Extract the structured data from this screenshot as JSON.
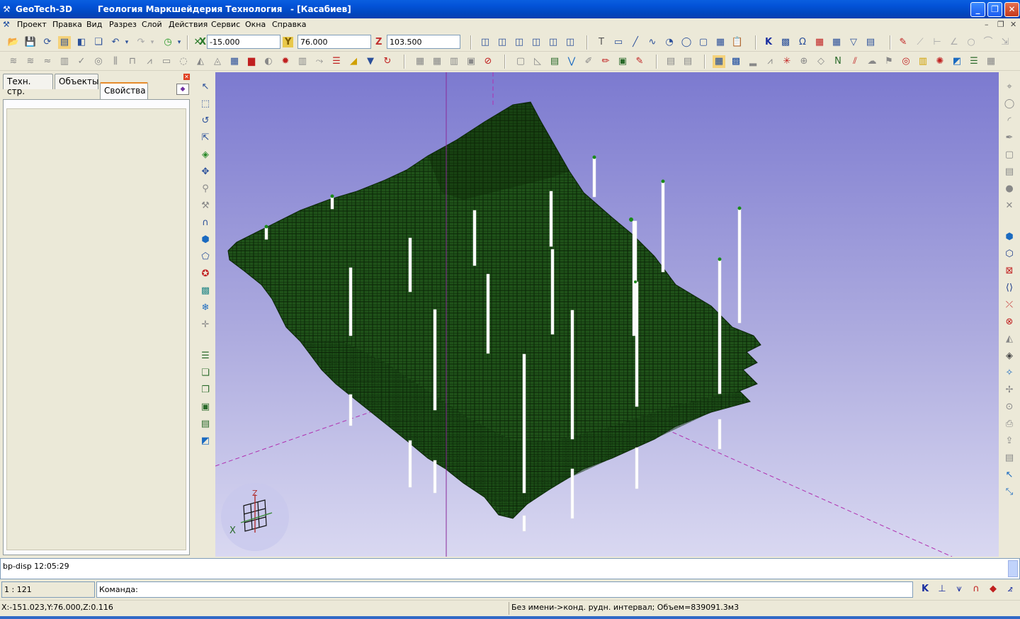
{
  "window": {
    "app_name": "GeoTech-3D",
    "subtitle": "Геология Маркшейдерия Технология",
    "document": "- [Касабиев]",
    "app_icon": "app-logo-icon"
  },
  "menu": [
    "Проект",
    "Правка",
    "Вид",
    "Разрез",
    "Слой",
    "Действия",
    "Сервис",
    "Окна",
    "Справка"
  ],
  "coords": {
    "x_label": "X",
    "x_value": "-15.000",
    "y_label": "Y",
    "y_value": "76.000",
    "z_label": "Z",
    "z_value": "103.500"
  },
  "left_panel": {
    "tabs": [
      "Техн. стр.",
      "Объекты",
      "Свойства"
    ],
    "active_tab": "Свойства"
  },
  "viewport": {
    "axis_x_label": "X",
    "axis_z_label": "Z",
    "block_color": "#1f5219",
    "block_grid_color": "#0b2407",
    "background_top": "#7c7ad0",
    "background_bottom": "#d9d8f1",
    "axis_color": "#b030b0"
  },
  "command": {
    "output": "bp-disp 12:05:29",
    "scale": "1 : 121",
    "prompt": "Команда:"
  },
  "status": {
    "cursor": "X:-151.023,Y:76.000,Z:0.116",
    "info": "Без имени->конд. рудн. интервал; Объем=839091.3м3"
  },
  "colors": {
    "titlebar": "#0353d8",
    "chrome": "#ece9d8",
    "accent": "#e68b2c"
  }
}
